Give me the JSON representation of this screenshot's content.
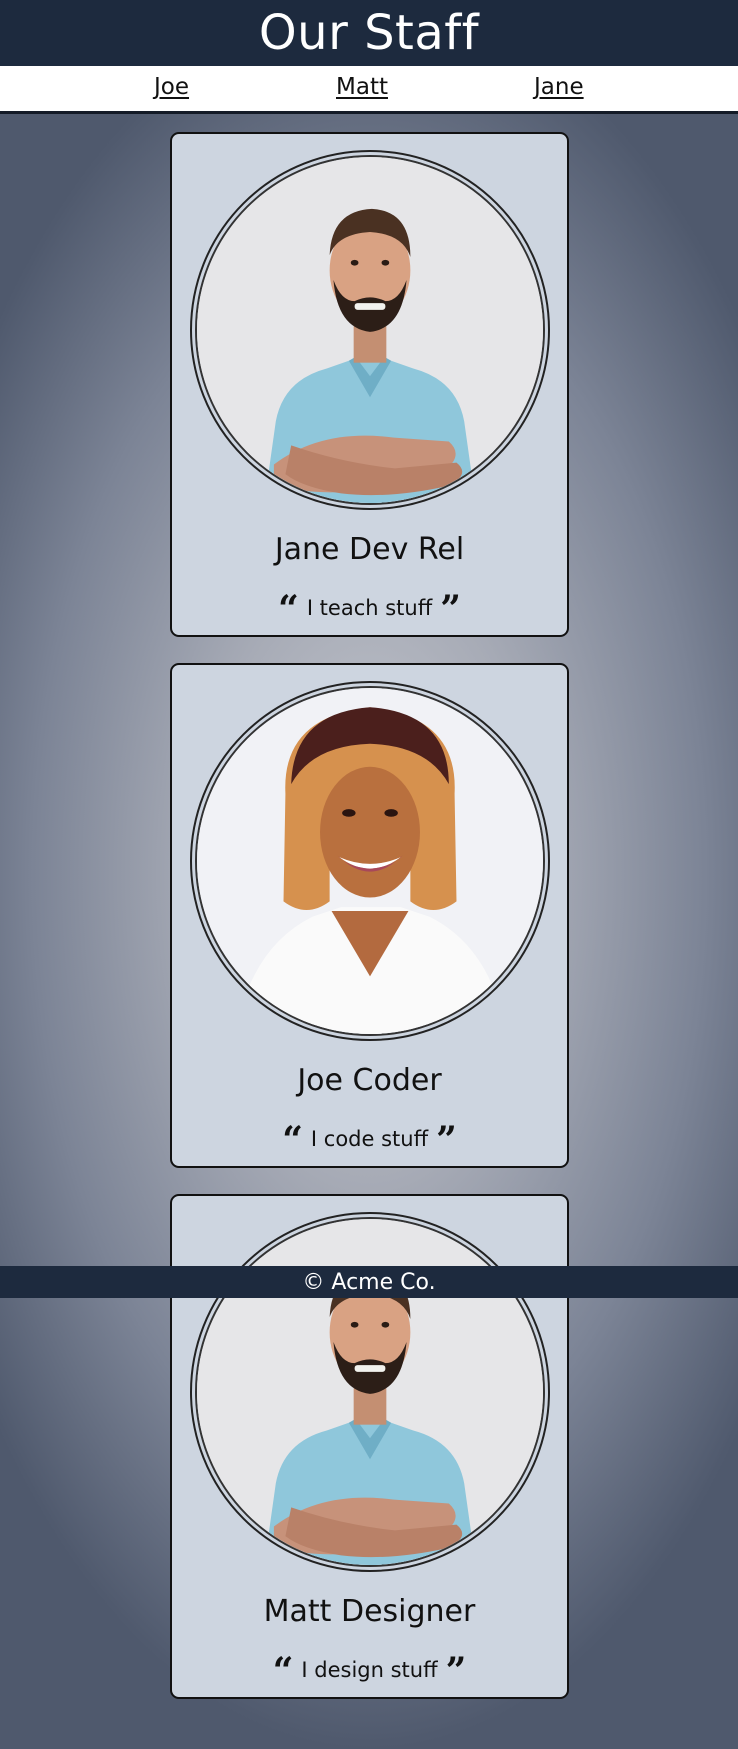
{
  "header": {
    "title": "Our Staff"
  },
  "nav": {
    "links": [
      "Joe",
      "Matt",
      "Jane"
    ]
  },
  "cards": [
    {
      "name": "Jane Dev Rel",
      "quote": "I teach stuff",
      "photo": "smiling bearded man in light blue polo shirt with arms crossed"
    },
    {
      "name": "Joe Coder",
      "quote": "I code stuff",
      "photo": "smiling woman with ombre bob haircut in white top"
    },
    {
      "name": "Matt Designer",
      "quote": "I design stuff",
      "photo": "smiling bearded man in light blue polo shirt with arms crossed"
    }
  ],
  "quote_marks": {
    "open": "“",
    "close": "”"
  },
  "footer": {
    "text": "© Acme Co."
  },
  "colors": {
    "header_bg": "#1d2a3e",
    "card_bg": "#cdd5e0",
    "page_bg_center": "#c6c9d0",
    "page_bg_edge": "#4f596d"
  }
}
